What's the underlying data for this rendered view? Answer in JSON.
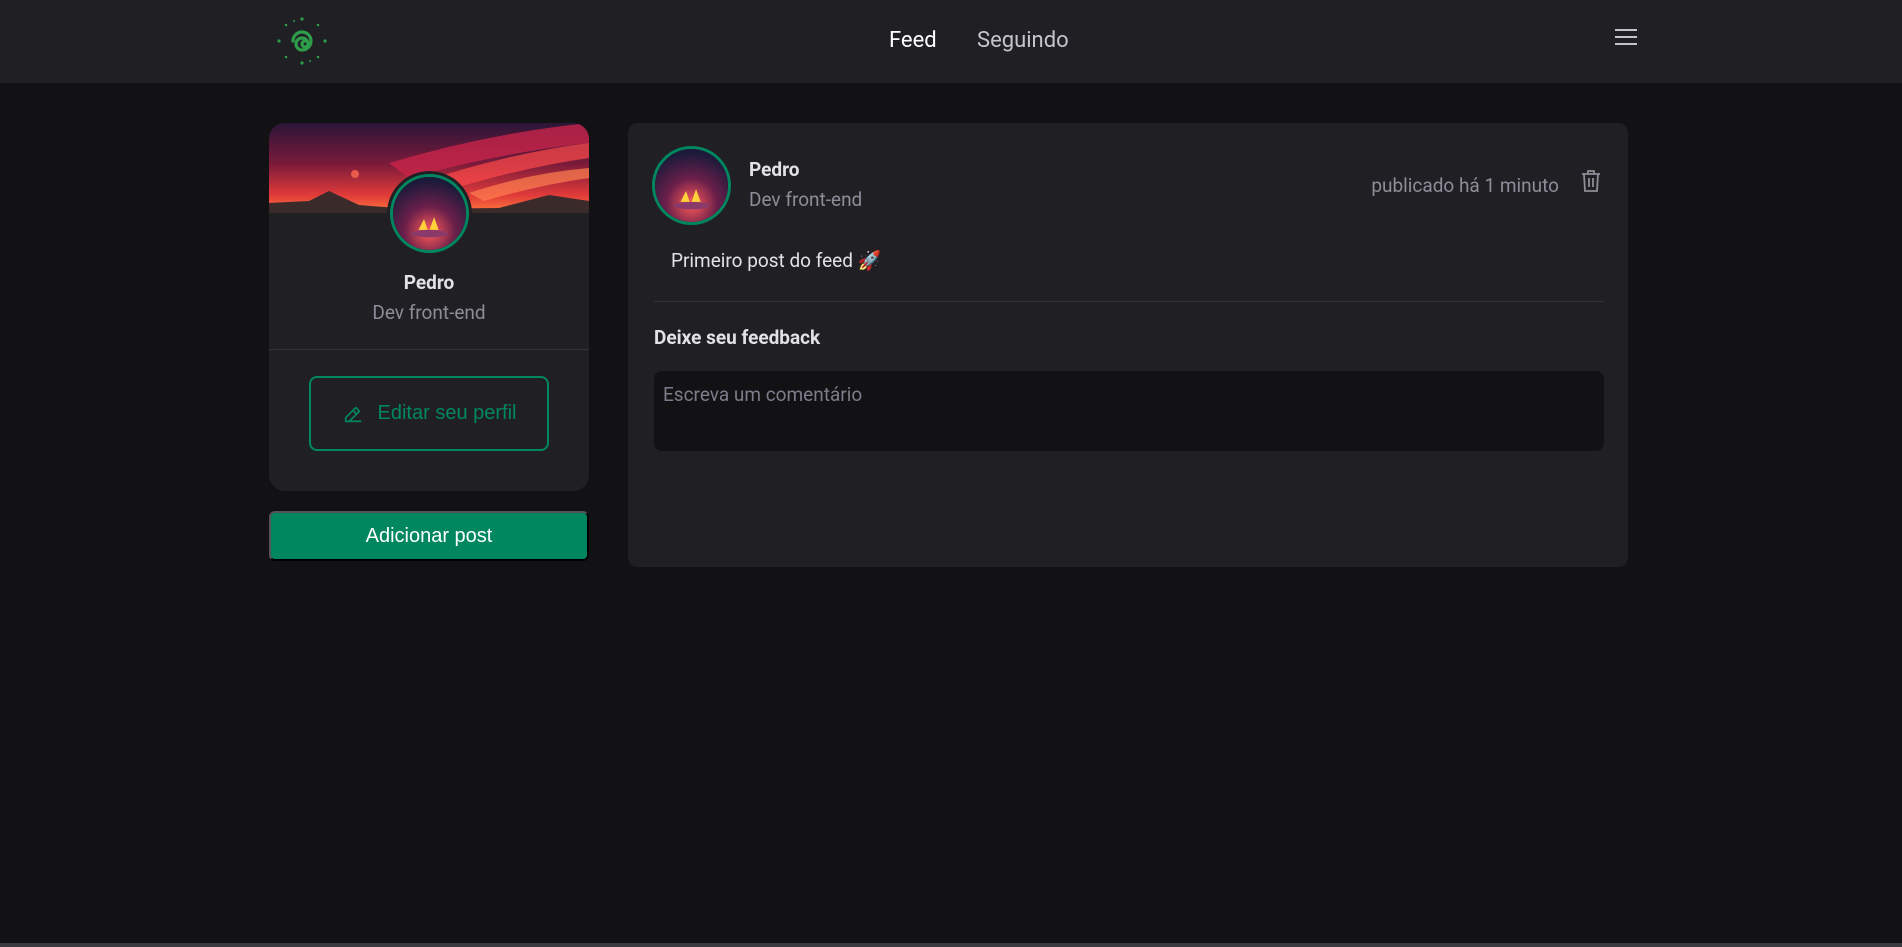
{
  "colors": {
    "background": "#121214",
    "surface": "#202024",
    "accent": "#00875f",
    "text": "#e1e1e6",
    "muted": "#8d8d99"
  },
  "header": {
    "logo": "spiral-logo-icon",
    "nav": {
      "feed": "Feed",
      "following": "Seguindo"
    },
    "menu_icon": "hamburger-menu-icon"
  },
  "sidebar": {
    "name": "Pedro",
    "role": "Dev front-end",
    "edit_label": "Editar seu perfil",
    "edit_icon": "pencil-icon"
  },
  "add_post_label": "Adicionar post",
  "post": {
    "author": "Pedro",
    "role": "Dev front-end",
    "published": "publicado há 1 minuto",
    "content": "Primeiro post do feed 🚀",
    "delete_icon": "trash-icon",
    "feedback_title": "Deixe seu feedback",
    "comment_placeholder": "Escreva um comentário"
  }
}
